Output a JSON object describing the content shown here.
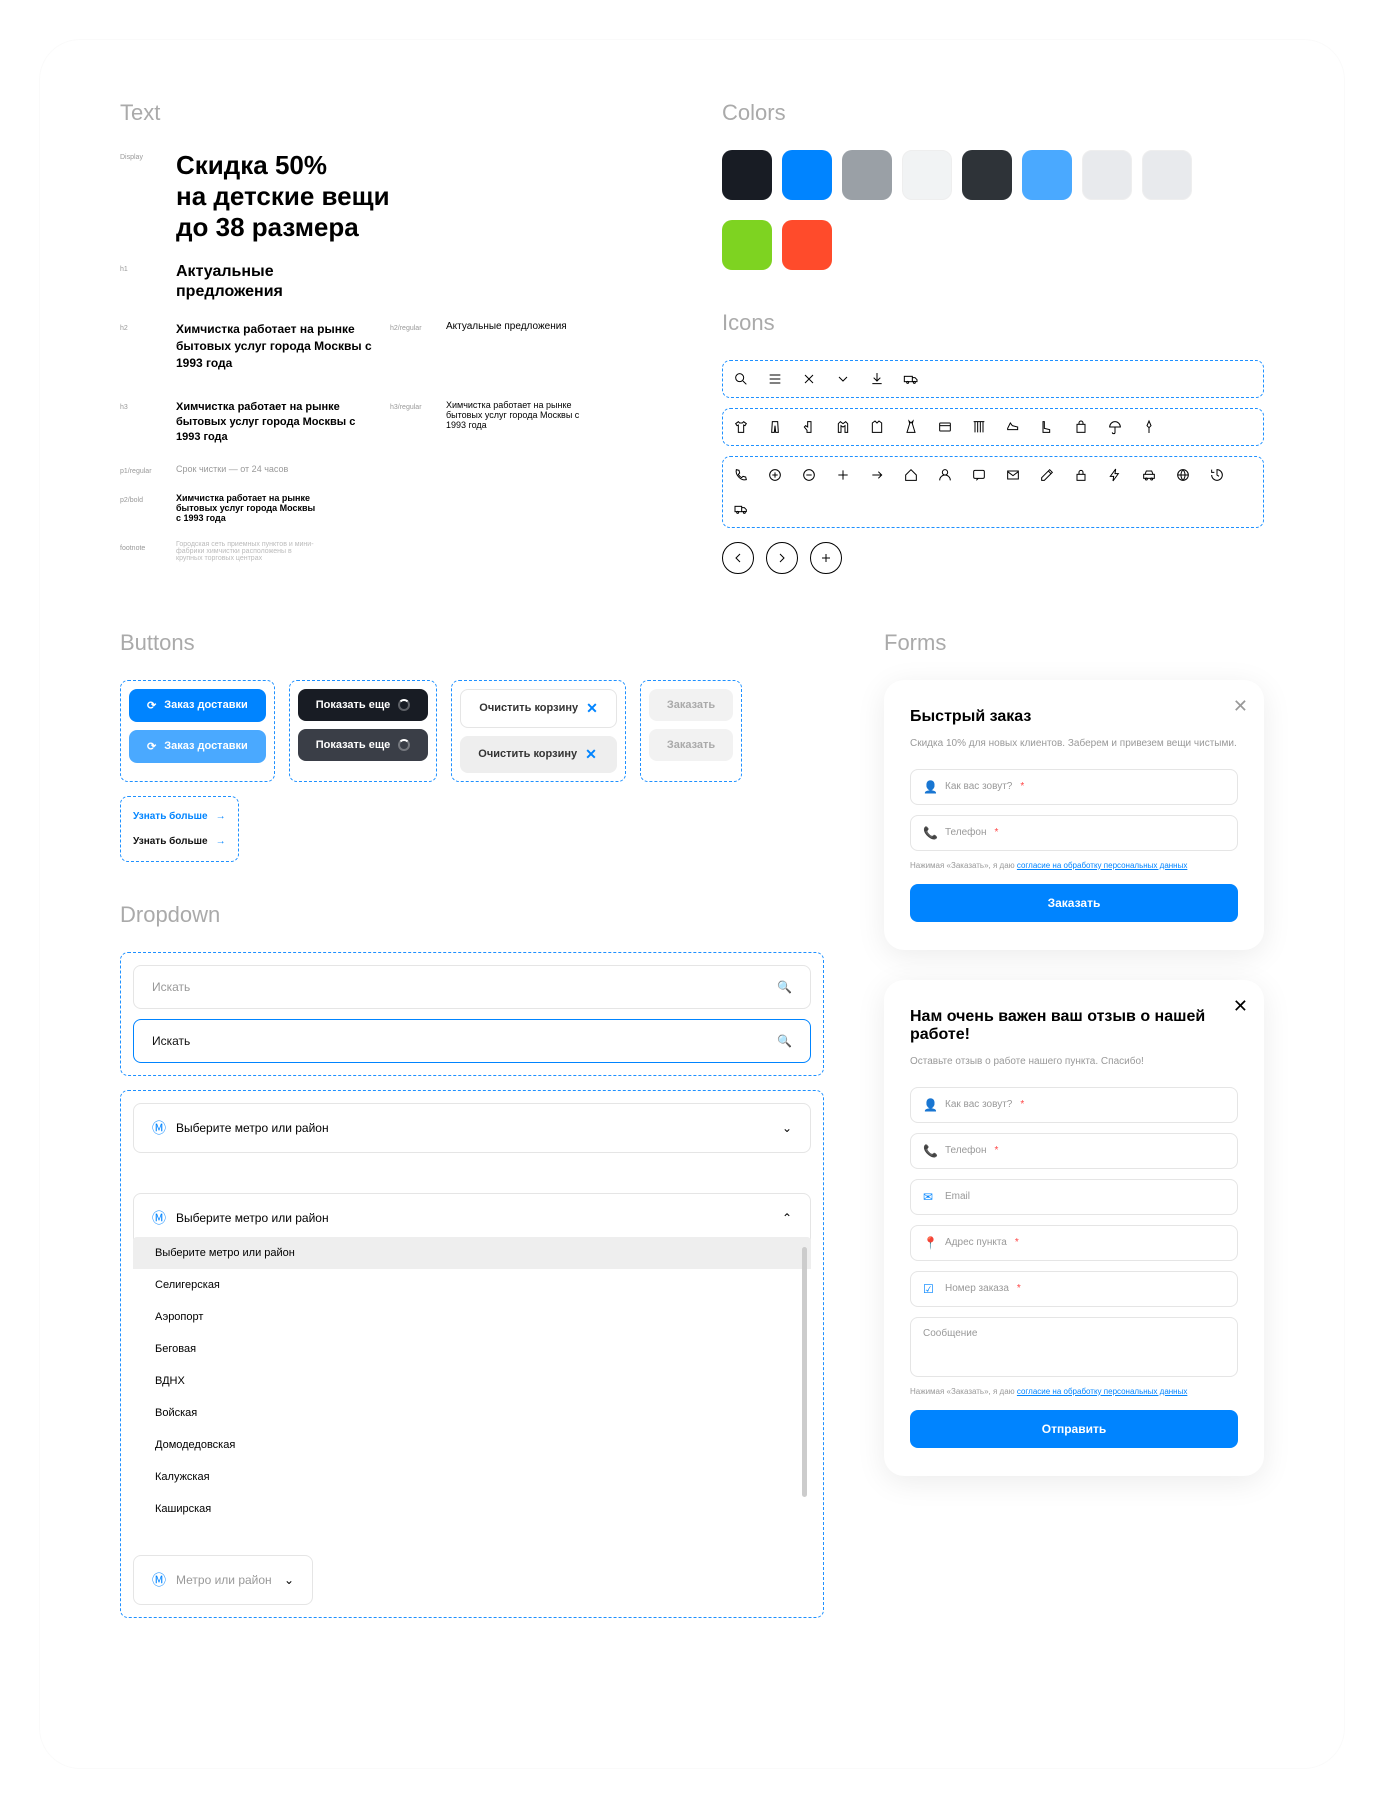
{
  "sections": {
    "text": "Text",
    "colors": "Colors",
    "icons": "Icons",
    "buttons": "Buttons",
    "forms": "Forms",
    "dropdown": "Dropdown"
  },
  "text": {
    "display_label": "Display",
    "display": "Скидка 50%\nна детские вещи\nдо 38 размера",
    "h1_label": "h1",
    "h1": "Актуальные\nпредложения",
    "h2_label": "h2",
    "h2": "Химчистка работает на рынке бытовых услуг города Москвы с 1993 года",
    "h2reg_label": "h2/regular",
    "h2reg": "Актуальные предложения",
    "h3_label": "h3",
    "h3": "Химчистка работает на рынке бытовых услуг города Москвы с 1993 года",
    "h3reg_label": "h3/regular",
    "h3reg": "Химчистка работает на рынке бытовых услуг города Москвы с 1993 года",
    "p1reg_label": "p1/regular",
    "p1reg": "Срок чистки — от 24 часов",
    "p2b_label": "p2/bold",
    "p2b": "Химчистка работает на рынке бытовых услуг города Москвы с 1993 года",
    "foot_label": "footnote",
    "foot": "Городская сеть приемных пунктов и мини-фабрики химчистки расположены в крупных торговых центрах"
  },
  "colors": [
    "#181C24",
    "#0084FF",
    "#9AA0A6",
    "#F1F3F4",
    "#2E3338",
    "#4AA9FF",
    "#E8EAED",
    "#E8EAED",
    "#7ED321",
    "#FF4B2B"
  ],
  "buttons": {
    "order": "Заказ доставки",
    "more": "Показать еще",
    "clear": "Очистить корзину",
    "submit": "Заказать",
    "learn": "Узнать больше"
  },
  "dropdown": {
    "search": "Искать",
    "metro_ph": "Выберите метро или район",
    "metro_short": "Метро или район",
    "items": [
      "Выберите метро или район",
      "Селигерская",
      "Аэропорт",
      "Беговая",
      "ВДНХ",
      "Войская",
      "Домодедовская",
      "Калужская",
      "Каширская"
    ]
  },
  "forms": {
    "f1": {
      "title": "Быстрый заказ",
      "sub": "Скидка 10% для новых клиентов. Заберем и привезем вещи чистыми.",
      "name": "Как вас зовут?",
      "phone": "Телефон",
      "note_pre": "Нажимая «Заказать», я даю ",
      "note_link": "согласие на обработку персональных данных",
      "btn": "Заказать"
    },
    "f2": {
      "title": "Нам очень важен ваш отзыв о нашей работе!",
      "sub": "Оставьте отзыв о работе нашего пункта. Спасибо!",
      "name": "Как вас зовут?",
      "phone": "Телефон",
      "email": "Email",
      "addr": "Адрес пункта",
      "order": "Номер заказа",
      "msg": "Сообщение",
      "note_pre": "Нажимая «Заказать», я даю ",
      "note_link": "согласие на обработку персональных данных",
      "btn": "Отправить"
    }
  }
}
